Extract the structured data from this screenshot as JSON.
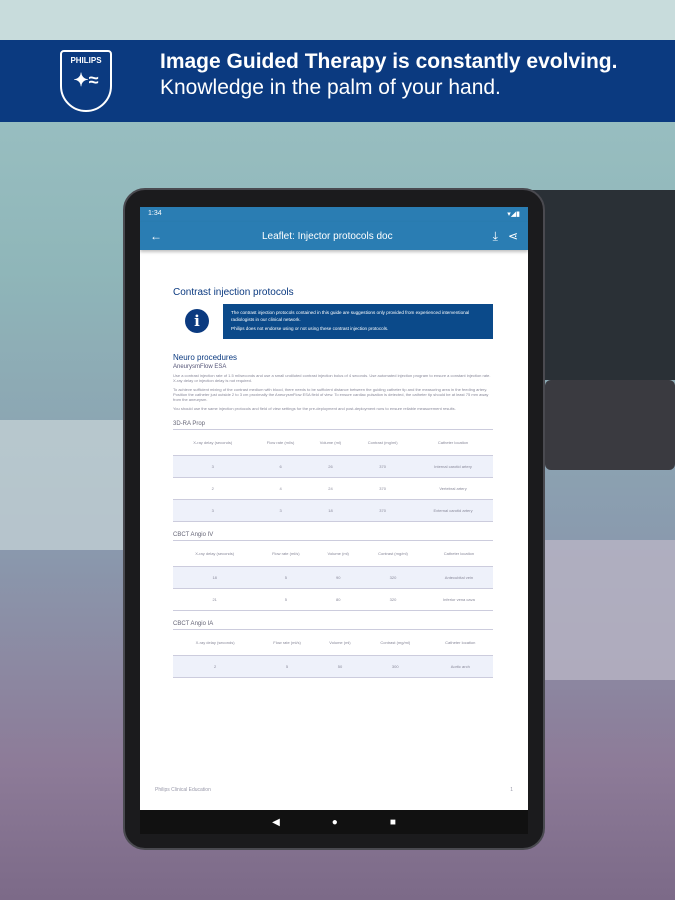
{
  "banner": {
    "brand": "PHILIPS",
    "line1": "Image Guided Therapy is constantly evolving.",
    "line2": "Knowledge in the palm of your hand."
  },
  "status": {
    "time": "1:34"
  },
  "appbar": {
    "title": "Leaflet: Injector protocols doc"
  },
  "doc": {
    "title": "Contrast injection protocols",
    "info": [
      "The contrast injection protocols contained in this guide are suggestions only provided from experienced interventional radiologists in our clinical network.",
      "Philips does not endorse using or not using these contrast injection protocols."
    ],
    "section": "Neuro procedures",
    "subsection": "AneurysmFlow ESA",
    "paragraphs": [
      "Use a contrast injection rate of 1.5 ml/seconds and use a small undiluted contrast injection bolus of 4 seconds. Use automated injection program to ensure a constant injection rate. X-ray delay or injection delay is not required.",
      "To achieve sufficient mixing of the contrast medium with blood, there needs to be sufficient distance between the guiding catheter tip and the measuring area in the feeding artery. Position the catheter just outside 2 to 3 cm proximally the AneurysmFlow ESA field of view. To ensure cardiac pulsation is detected, the catheter tip should be at least 75 mm away from the aneurysm.",
      "You should use the same injection protocols and field of view settings for the pre-deployment and post-deployment runs to ensure reliable measurement results."
    ],
    "headers": [
      "X-ray delay (seconds)",
      "Flow rate (ml/s)",
      "Volume (ml)",
      "Contrast (mg/ml)",
      "Catheter location"
    ],
    "tables": [
      {
        "title": "3D-RA Prop",
        "rows": [
          [
            "3",
            "6",
            "26",
            "370",
            "Internal carotid artery"
          ],
          [
            "2",
            "4",
            "24",
            "370",
            "Vertebral artery"
          ],
          [
            "3",
            "3",
            "18",
            "370",
            "External carotid artery"
          ]
        ]
      },
      {
        "title": "CBCT Angio IV",
        "rows": [
          [
            "18",
            "5",
            "90",
            "320",
            "Antecubital vein"
          ],
          [
            "21",
            "5",
            "80",
            "320",
            "Inferior vena cava"
          ]
        ]
      },
      {
        "title": "CBCT Angio IA",
        "rows": [
          [
            "2",
            "5",
            "50",
            "300",
            "Aortic arch"
          ]
        ]
      }
    ],
    "footer": "Philips Clinical Education",
    "page": "1"
  }
}
